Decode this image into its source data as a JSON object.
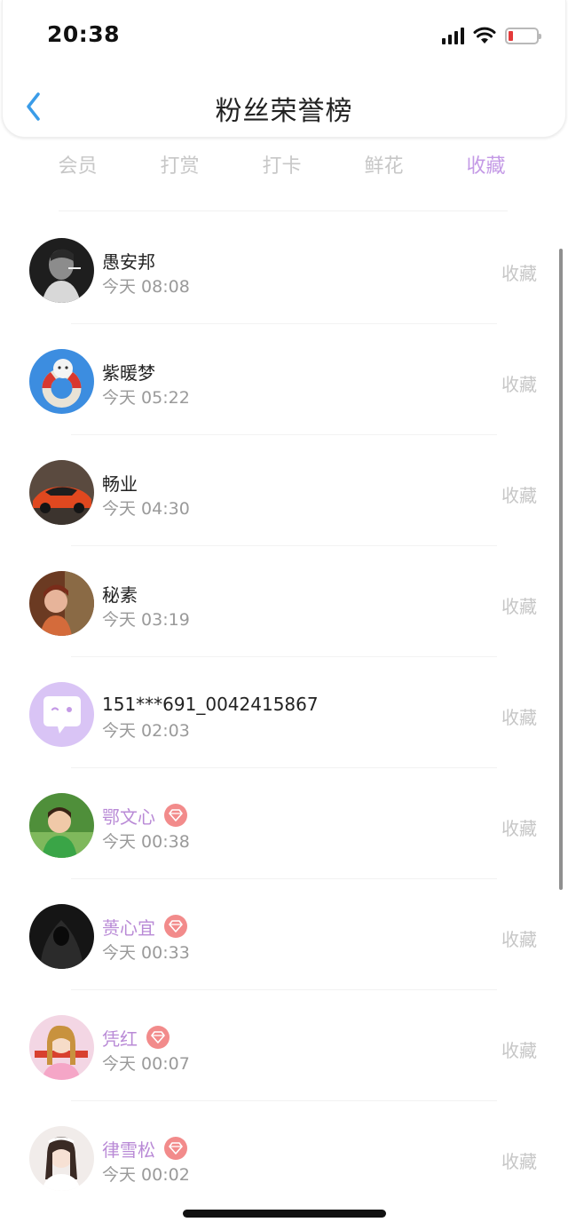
{
  "status_bar": {
    "time": "20:38"
  },
  "header": {
    "title": "粉丝荣誉榜"
  },
  "tabs": [
    {
      "label": "会员",
      "active": false
    },
    {
      "label": "打赏",
      "active": false
    },
    {
      "label": "打卡",
      "active": false
    },
    {
      "label": "鲜花",
      "active": false
    },
    {
      "label": "收藏",
      "active": true
    }
  ],
  "colors": {
    "accent": "#c49ae6",
    "vip_name": "#b98ad6",
    "vip_badge": "#f28b8b",
    "back_arrow": "#3a9ce8",
    "battery_low": "#e43a3a"
  },
  "fans": [
    {
      "name": "愚安邦",
      "time": "今天 08:08",
      "action": "收藏",
      "vip": false
    },
    {
      "name": "紫暖梦",
      "time": "今天 05:22",
      "action": "收藏",
      "vip": false
    },
    {
      "name": "畅业",
      "time": "今天 04:30",
      "action": "收藏",
      "vip": false
    },
    {
      "name": "秘素",
      "time": "今天 03:19",
      "action": "收藏",
      "vip": false
    },
    {
      "name": "151***691_0042415867",
      "time": "今天 02:03",
      "action": "收藏",
      "vip": false
    },
    {
      "name": "鄂文心",
      "time": "今天 00:38",
      "action": "收藏",
      "vip": true
    },
    {
      "name": "蒉心宜",
      "time": "今天 00:33",
      "action": "收藏",
      "vip": true
    },
    {
      "name": "凭红",
      "time": "今天 00:07",
      "action": "收藏",
      "vip": true
    },
    {
      "name": "律雪松",
      "time": "今天 00:02",
      "action": "收藏",
      "vip": true
    }
  ]
}
